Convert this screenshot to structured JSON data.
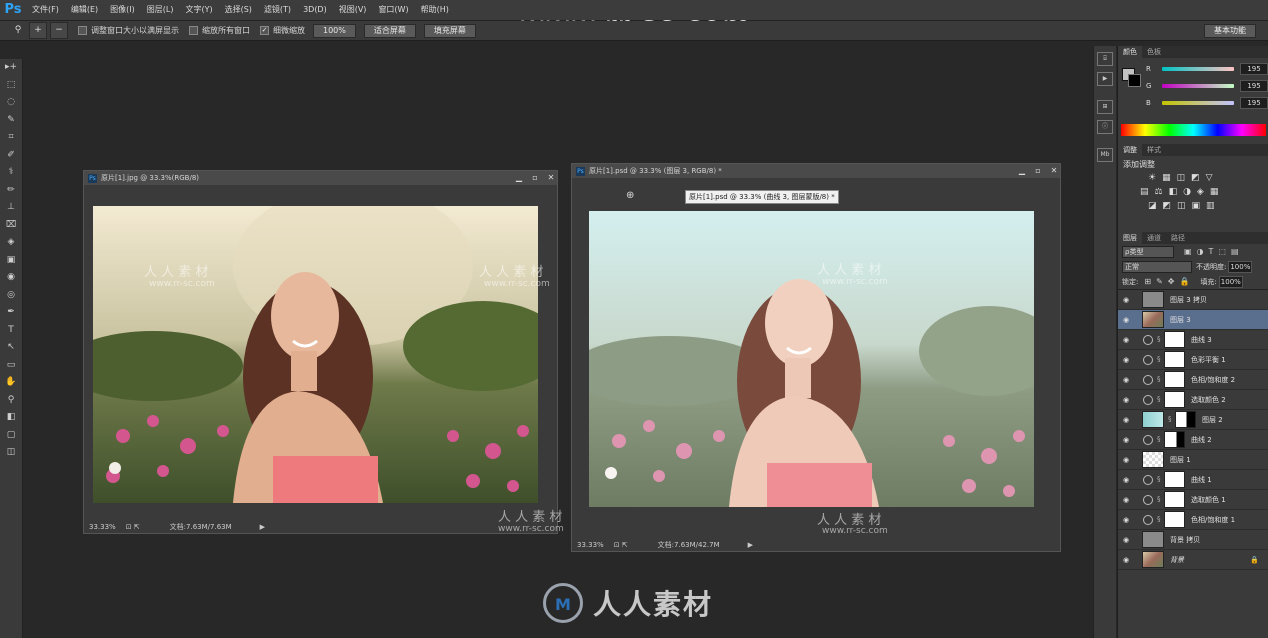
{
  "app": {
    "logo": "Ps"
  },
  "menu": [
    "文件(F)",
    "编辑(E)",
    "图像(I)",
    "图层(L)",
    "文字(Y)",
    "选择(S)",
    "滤镜(T)",
    "3D(D)",
    "视图(V)",
    "窗口(W)",
    "帮助(H)"
  ],
  "options": {
    "zoom_icon": "⚲",
    "check_resize": "调整窗口大小以满屏显示",
    "check_all_windows": "缩放所有窗口",
    "check_scrubby": "细微缩放",
    "btn_100": "100%",
    "btn_fit": "适合屏幕",
    "btn_fill": "填充屏幕",
    "workspace": "基本功能"
  },
  "watermark": {
    "url": "www.rr-sc.com",
    "cn": "人人素材",
    "cn_spaced": "人 人 素 材",
    "logo_letters": "M"
  },
  "tools": [
    "▸+",
    "⬚",
    "◌",
    "✎",
    "⌗",
    "✐",
    "⚕",
    "✏",
    "⊥",
    "⌧",
    "◈",
    "▣",
    "◉",
    "◎",
    "✒",
    "T",
    "↖",
    "▭",
    "✋",
    "⚲",
    "◧",
    "▢",
    "◫"
  ],
  "doc1": {
    "title": "原片[1].jpg @ 33.3%(RGB/8)",
    "zoom": "33.33%",
    "doc_size": "文档:7.63M/7.63M"
  },
  "doc2": {
    "title": "原片[1].psd @ 33.3% (图层 3, RGB/8) *",
    "tooltip": "原片[1].psd @ 33.3% (曲线 3, 图层蒙版/8) *",
    "zoom": "33.33%",
    "doc_size": "文档:7.63M/42.7M"
  },
  "color_panel": {
    "tabs": [
      "颜色",
      "色板"
    ],
    "r_label": "R",
    "g_label": "G",
    "b_label": "B",
    "r": "195",
    "g": "195",
    "b": "195"
  },
  "adjust_panel": {
    "tabs": [
      "调整",
      "样式"
    ],
    "title": "添加调整"
  },
  "layers_panel": {
    "tabs": [
      "图层",
      "通道",
      "路径"
    ],
    "filter": "ρ类型",
    "blend_mode": "正常",
    "opacity_label": "不透明度:",
    "opacity": "100%",
    "lock_label": "锁定:",
    "fill_label": "填充:",
    "fill": "100%",
    "layers": [
      {
        "name": "图层 3 拷贝",
        "kind": "pixel-gray"
      },
      {
        "name": "图层 3",
        "kind": "pixel-photo",
        "selected": true
      },
      {
        "name": "曲线 3",
        "kind": "adjust"
      },
      {
        "name": "色彩平衡 1",
        "kind": "adjust"
      },
      {
        "name": "色相/饱和度 2",
        "kind": "adjust"
      },
      {
        "name": "选取颜色 2",
        "kind": "adjust"
      },
      {
        "name": "图层 2",
        "kind": "pixel-mask"
      },
      {
        "name": "曲线 2",
        "kind": "adjust-mask"
      },
      {
        "name": "图层 1",
        "kind": "pixel-checker"
      },
      {
        "name": "曲线 1",
        "kind": "adjust"
      },
      {
        "name": "选取颜色 1",
        "kind": "adjust"
      },
      {
        "name": "色相/饱和度 1",
        "kind": "adjust"
      },
      {
        "name": "背景 拷贝",
        "kind": "pixel-gray"
      },
      {
        "name": "背景",
        "kind": "pixel-photo",
        "locked": true
      }
    ]
  }
}
